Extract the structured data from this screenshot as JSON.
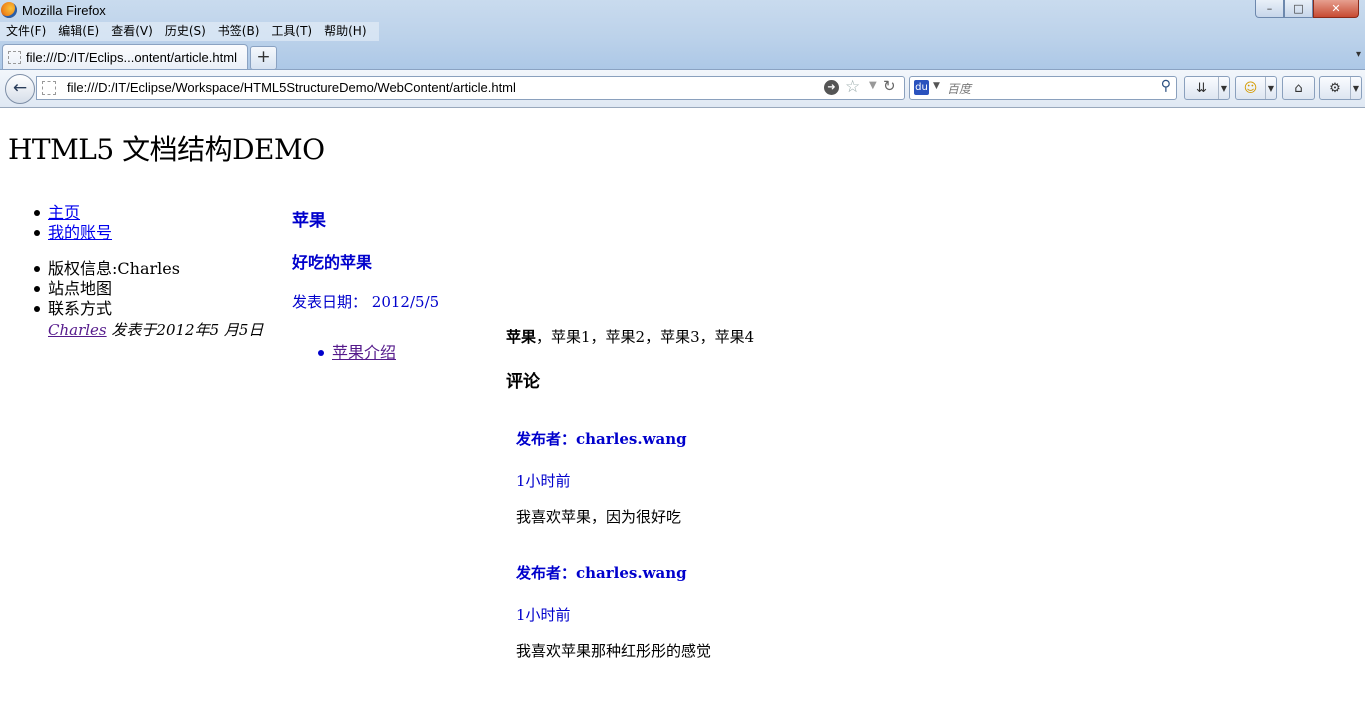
{
  "window": {
    "title": "Mozilla Firefox",
    "controls": {
      "minimize": "–",
      "maximize": "□",
      "close": "✕"
    }
  },
  "menu": [
    "文件(F)",
    "编辑(E)",
    "查看(V)",
    "历史(S)",
    "书签(B)",
    "工具(T)",
    "帮助(H)"
  ],
  "tabs": [
    {
      "title": "file:///D:/IT/Eclips...ontent/article.html",
      "active": true
    }
  ],
  "newtab_label": "+",
  "tablist_label": "▾",
  "navbar": {
    "back_label": "←",
    "url": "file:///D:/IT/Eclipse/Workspace/HTML5StructureDemo/WebContent/article.html",
    "search_placeholder": "百度",
    "search_engine_label": "du"
  },
  "page": {
    "heading": "HTML5 文档结构DEMO",
    "nav_links": [
      "主页",
      "我的账号"
    ],
    "footer_items": [
      "版权信息:Charles",
      "站点地图",
      "联系方式"
    ],
    "byline": {
      "author": "Charles",
      "text": "发表于2012年5 月5日"
    },
    "article": {
      "title": "苹果",
      "subtitle": "好吃的苹果",
      "date_label": "发表日期：",
      "date_value": "2012/5/5",
      "toc": [
        "苹果介绍"
      ],
      "paragraph_bold": "苹果",
      "paragraph_rest": "，苹果1，苹果2，苹果3，苹果4",
      "comments_heading": "评论",
      "comments": [
        {
          "author": "发布者：charles.wang",
          "time": "1小时前",
          "body": "我喜欢苹果，因为很好吃"
        },
        {
          "author": "发布者：charles.wang",
          "time": "1小时前",
          "body": "我喜欢苹果那种红彤彤的感觉"
        }
      ]
    }
  }
}
